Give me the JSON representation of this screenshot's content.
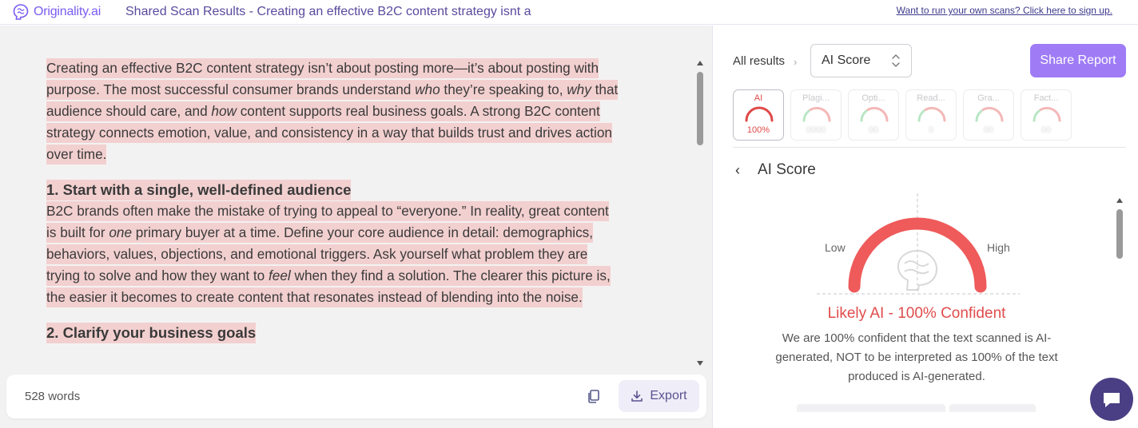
{
  "header": {
    "brand": "Originality.ai",
    "doc_title": "Shared Scan Results - Creating an effective B2C content strategy isnt a",
    "signup_link": "Want to run your own scans? Click here to sign up."
  },
  "document": {
    "p1": {
      "a": "Creating an effective B2C content strategy isn’t about posting more—it’s about posting with purpose. The most successful consumer brands understand ",
      "em1": "who",
      "b": " they’re speaking to, ",
      "em2": "why",
      "c": " that audience should care, and ",
      "em3": "how",
      "d": " content supports real business goals. A strong B2C content strategy connects emotion, value, and consistency in a way that builds trust and drives action over time."
    },
    "h1": "1. Start with a single, well-defined audience",
    "p2": {
      "a": "B2C brands often make the mistake of trying to appeal to “everyone.” In reality, great content is built for ",
      "em1": "one",
      "b": " primary buyer at a time. Define your core audience in detail: demographics, behaviors, values, objections, and emotional triggers. Ask yourself what problem they are trying to solve and how they want to ",
      "em2": "feel",
      "c": " when they find a solution. The clearer this picture is, the easier it becomes to create content that resonates instead of blending into the noise."
    },
    "h2": "2. Clarify your business goals"
  },
  "footer": {
    "word_count": "528 words",
    "export_label": "Export"
  },
  "results": {
    "all_results": "All results",
    "select_value": "AI Score",
    "share_label": "Share Report",
    "tabs": [
      {
        "label": "AI",
        "value": "100%",
        "color": "#e04848"
      },
      {
        "label": "Plagi...",
        "value": "0000",
        "color": "#f4b8b8"
      },
      {
        "label": "Opti...",
        "value": "00",
        "color": "#f4b8b8"
      },
      {
        "label": "Read...",
        "value": "0",
        "color": "#f4b8b8"
      },
      {
        "label": "Gra...",
        "value": "00",
        "color": "#f4b8b8"
      },
      {
        "label": "Fact...",
        "value": "00",
        "color": "#f4b8b8"
      }
    ],
    "panel_title": "AI Score",
    "gauge": {
      "low": "Low",
      "high": "High",
      "score": 1.0,
      "color": "#ef5a5a"
    },
    "verdict": "Likely AI - 100% Confident",
    "explanation": "We are 100% confident that the text scanned is AI-generated, NOT to be interpreted as 100% of the text produced is AI-generated."
  },
  "colors": {
    "brand": "#7a5cf0",
    "highlight": "#f3d0d0",
    "share_button": "#9f7cf6",
    "ai_red": "#e04848",
    "chat_bubble": "#4a3f84"
  }
}
